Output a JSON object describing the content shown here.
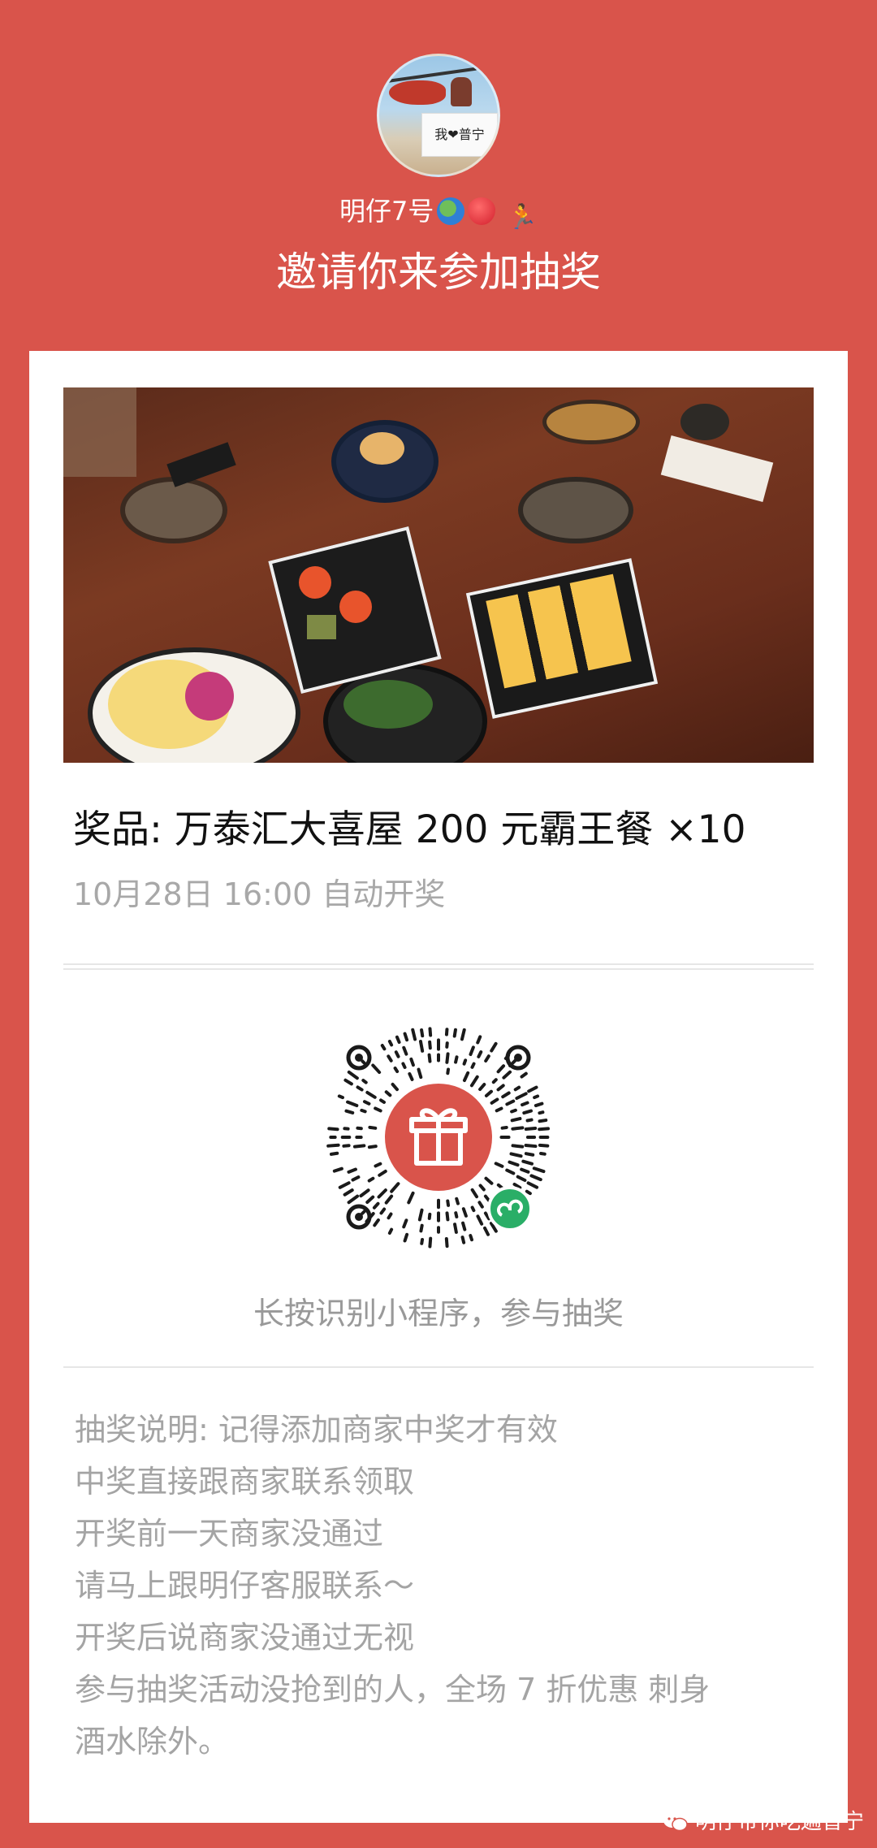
{
  "header": {
    "username": "明仔7号",
    "invite_title": "邀请你来参加抽奖",
    "avatar_banner_text": "我❤普宁"
  },
  "prize": {
    "title": "奖品: 万泰汇大喜屋 200 元霸王餐 ×10",
    "draw_time": "10月28日 16:00 自动开奖"
  },
  "qr": {
    "hint": "长按识别小程序，参与抽奖",
    "center_icon": "gift-icon",
    "badge_icon": "mini-program-icon"
  },
  "rules": {
    "lines": [
      "抽奖说明: 记得添加商家中奖才有效",
      "中奖直接跟商家联系领取",
      "开奖前一天商家没通过",
      "请马上跟明仔客服联系～",
      "开奖后说商家没通过无视",
      "参与抽奖活动没抢到的人，全场 7 折优惠 刺身",
      "酒水除外。"
    ]
  },
  "watermark": {
    "text": "明仔带你吃遍普宁"
  },
  "colors": {
    "background": "#d9544b",
    "card": "#ffffff",
    "qr_accent": "#d9544b",
    "badge": "#2aae67"
  }
}
